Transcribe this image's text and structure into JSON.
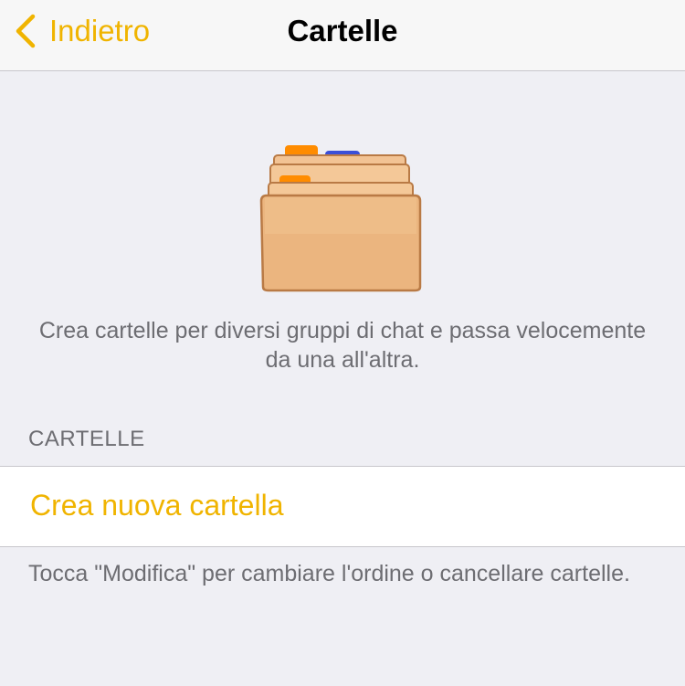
{
  "navbar": {
    "back_label": "Indietro",
    "title": "Cartelle"
  },
  "intro": {
    "text": "Crea cartelle per diversi gruppi di chat e passa velocemente da una all'altra."
  },
  "section": {
    "header": "CARTELLE",
    "create_label": "Crea nuova cartella",
    "footer": "Tocca \"Modifica\" per cambiare l'ordine o cancellare cartelle."
  },
  "colors": {
    "accent": "#f0b400",
    "background": "#efeff4",
    "secondary_text": "#6d6d72"
  },
  "icons": {
    "back": "chevron-left-icon",
    "illustration": "folders-icon"
  }
}
